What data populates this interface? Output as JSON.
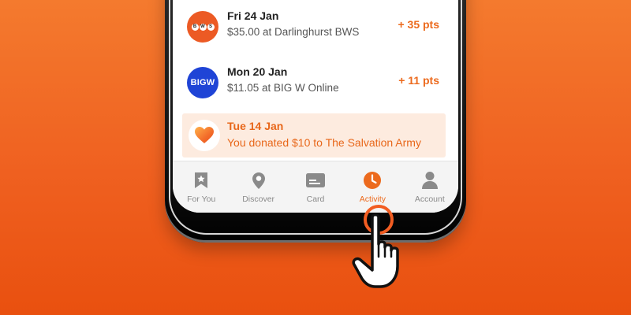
{
  "activity": [
    {
      "date": "Fri 24 Jan",
      "detail": "$35.00 at Darlinghurst BWS",
      "points": "+ 35 pts",
      "logo_icon": "bws-logo",
      "logo_letters": [
        "B",
        "W",
        "S"
      ]
    },
    {
      "date": "Mon 20 Jan",
      "detail": "$11.05 at BIG W Online",
      "points": "+ 11 pts",
      "logo_icon": "bigw-logo",
      "logo_text": "BIGW"
    }
  ],
  "donation": {
    "date": "Tue 14 Jan",
    "detail": "You donated $10 to The Salvation Army",
    "icon": "heart-icon"
  },
  "nav": [
    {
      "label": "For You",
      "icon": "bookmark-star-icon",
      "active": false
    },
    {
      "label": "Discover",
      "icon": "location-pin-icon",
      "active": false
    },
    {
      "label": "Card",
      "icon": "card-icon",
      "active": false
    },
    {
      "label": "Activity",
      "icon": "clock-icon",
      "active": true
    },
    {
      "label": "Account",
      "icon": "person-icon",
      "active": false
    }
  ],
  "colors": {
    "background_top": "#f47a2e",
    "background_bottom": "#e9500f",
    "accent": "#ec6a1d",
    "bigw_blue": "#1f44d6",
    "bws_orange": "#ec5a24",
    "donation_bg": "#fdebdf"
  }
}
